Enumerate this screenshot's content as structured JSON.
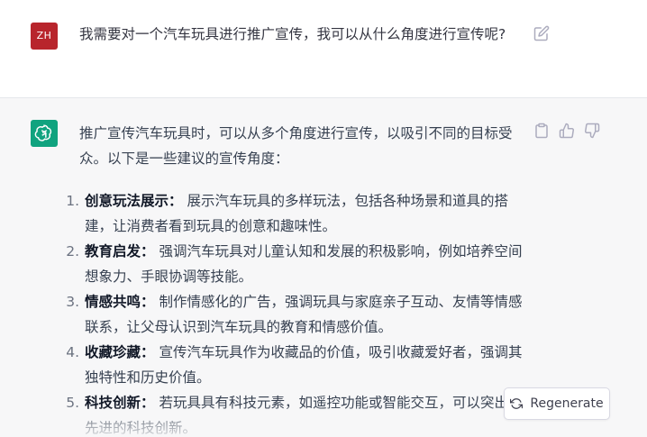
{
  "user": {
    "avatar_initials": "ZH",
    "avatar_color": "#b8252c",
    "message": "我需要对一个汽车玩具进行推广宣传，我可以从什么角度进行宣传呢?"
  },
  "assistant": {
    "avatar_color": "#10a37f",
    "intro": "推广宣传汽车玩具时，可以从多个角度进行宣传，以吸引不同的目标受众。以下是一些建议的宣传角度：",
    "items": [
      {
        "num": "1.",
        "title": "创意玩法展示：",
        "text": " 展示汽车玩具的多样玩法，包括各种场景和道具的搭建，让消费者看到玩具的创意和趣味性。"
      },
      {
        "num": "2.",
        "title": "教育启发：",
        "text": " 强调汽车玩具对儿童认知和发展的积极影响，例如培养空间想象力、手眼协调等技能。"
      },
      {
        "num": "3.",
        "title": "情感共鸣：",
        "text": " 制作情感化的广告，强调玩具与家庭亲子互动、友情等情感联系，让父母认识到汽车玩具的教育和情感价值。"
      },
      {
        "num": "4.",
        "title": "收藏珍藏：",
        "text": " 宣传汽车玩具作为收藏品的价值，吸引收藏爱好者，强调其独特性和历史价值。"
      },
      {
        "num": "5.",
        "title": "科技创新：",
        "text": " 若玩具具有科技元素，如遥控功能或智能交互，可以突出其先进的科技创新。"
      }
    ]
  },
  "icons": {
    "edit": "edit-icon",
    "copy": "copy-icon",
    "thumbs_up": "thumbs-up-icon",
    "thumbs_down": "thumbs-down-icon",
    "regenerate": "refresh-icon"
  },
  "buttons": {
    "regenerate_label": "Regenerate"
  }
}
